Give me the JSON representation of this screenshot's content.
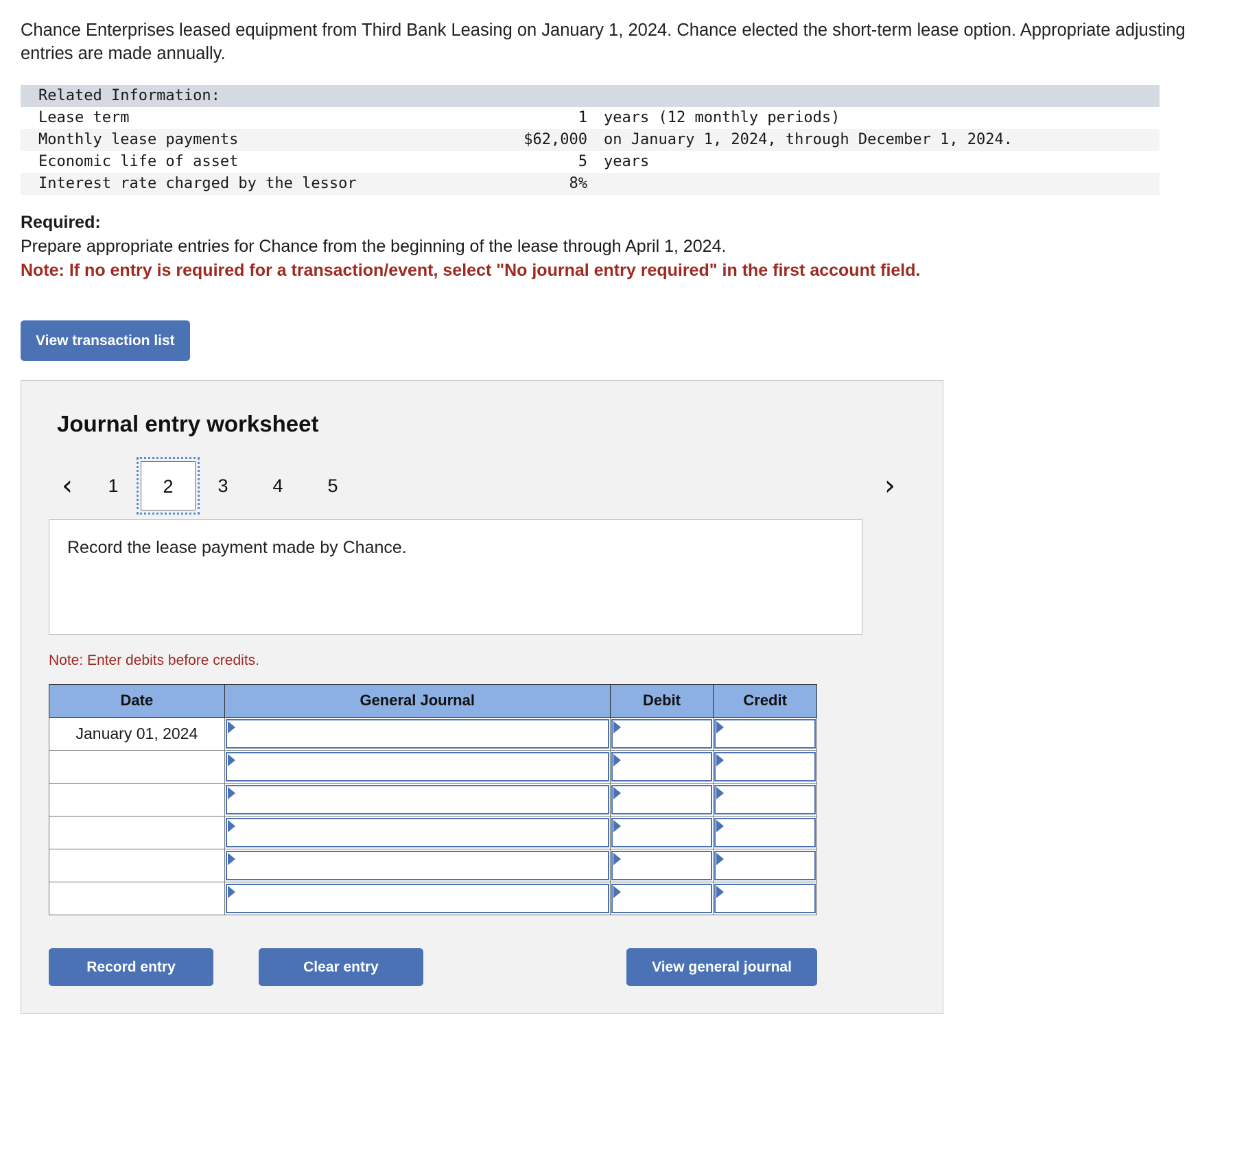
{
  "intro": "Chance Enterprises leased equipment from Third Bank Leasing on January 1, 2024. Chance elected the short-term lease option. Appropriate adjusting entries are made annually.",
  "related_information": {
    "header": "Related Information:",
    "rows": [
      {
        "label": "Lease term",
        "value": "1",
        "note": "years (12 monthly periods)"
      },
      {
        "label": "Monthly lease payments",
        "value": "$62,000",
        "note": "on January 1, 2024, through December 1, 2024."
      },
      {
        "label": "Economic life of asset",
        "value": "5",
        "note": "years"
      },
      {
        "label": "Interest rate charged by the lessor",
        "value": "8%",
        "note": ""
      }
    ]
  },
  "required": {
    "title": "Required:",
    "line": "Prepare appropriate entries for Chance from the beginning of the lease through April 1, 2024.",
    "note": "Note: If no entry is required for a transaction/event, select \"No journal entry required\" in the first account field."
  },
  "buttons": {
    "view_transaction_list": "View transaction list",
    "record_entry": "Record entry",
    "clear_entry": "Clear entry",
    "view_general_journal": "View general journal"
  },
  "worksheet": {
    "title": "Journal entry worksheet",
    "pager": {
      "prev_icon": "‹",
      "next_icon": "›",
      "pages": [
        "1",
        "2",
        "3",
        "4",
        "5"
      ],
      "active_page": "2"
    },
    "description": "Record the lease payment made by Chance.",
    "debit_note": "Note: Enter debits before credits.",
    "table": {
      "columns": [
        "Date",
        "General Journal",
        "Debit",
        "Credit"
      ],
      "rows": [
        {
          "date": "January 01, 2024",
          "general_journal": "",
          "debit": "",
          "credit": ""
        },
        {
          "date": "",
          "general_journal": "",
          "debit": "",
          "credit": ""
        },
        {
          "date": "",
          "general_journal": "",
          "debit": "",
          "credit": ""
        },
        {
          "date": "",
          "general_journal": "",
          "debit": "",
          "credit": ""
        },
        {
          "date": "",
          "general_journal": "",
          "debit": "",
          "credit": ""
        },
        {
          "date": "",
          "general_journal": "",
          "debit": "",
          "credit": ""
        }
      ]
    }
  },
  "colors": {
    "button_blue": "#4a72b5",
    "table_header_blue": "#8cb0e3",
    "info_header_gray": "#d5d9e2",
    "note_red": "#9e2a22",
    "panel_bg": "#f2f2f2"
  }
}
